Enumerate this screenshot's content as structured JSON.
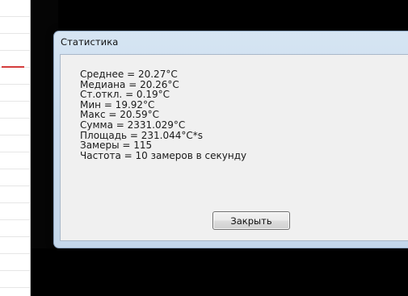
{
  "dialog": {
    "title": "Статистика",
    "stats": [
      "Среднее = 20.27°C",
      "Медиана = 20.26°C",
      "Ст.откл. = 0.19°C",
      "Мин = 19.92°C",
      "Макс = 20.59°C",
      "Сумма = 2331.029°C",
      "Площадь = 231.044°C*s",
      "Замеры = 115",
      "Частота = 10 замеров в секунду"
    ],
    "close_label": "Закрыть"
  },
  "colors": {
    "dialog_frame": "#c9dbee",
    "background": "#000000",
    "accent_line": "#d43c3c"
  }
}
